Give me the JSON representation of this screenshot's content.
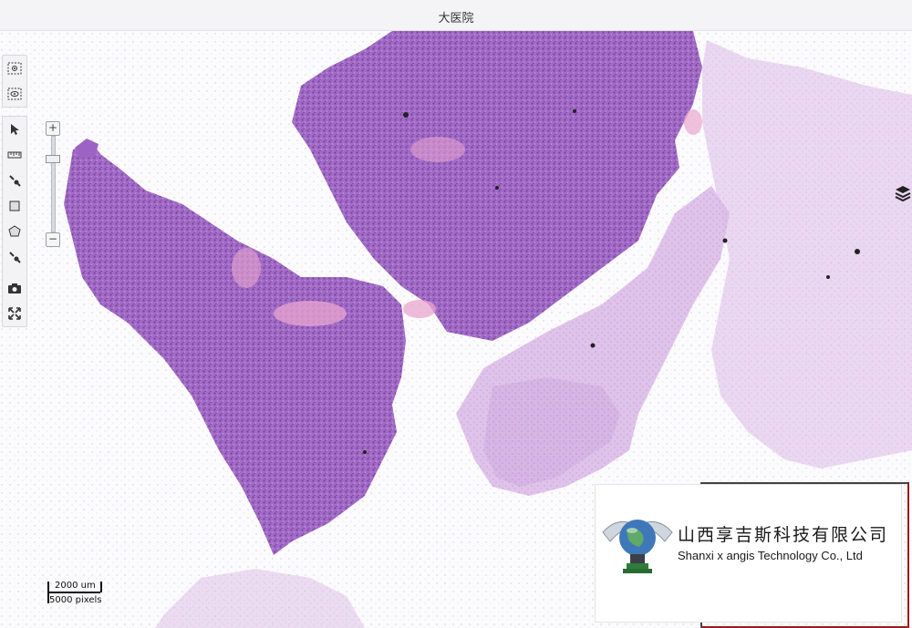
{
  "window": {
    "title": "大医院"
  },
  "toolbar_top": [
    {
      "name": "region-select-icon",
      "label": ""
    },
    {
      "name": "region-view-icon",
      "label": ""
    }
  ],
  "toolbar_main": [
    {
      "name": "pointer-icon"
    },
    {
      "name": "ruler-icon"
    },
    {
      "name": "pen-icon"
    },
    {
      "name": "rectangle-icon"
    },
    {
      "name": "polygon-icon"
    },
    {
      "name": "brush-icon"
    },
    {
      "name": "camera-icon"
    },
    {
      "name": "fullscreen-icon"
    }
  ],
  "zoom": {
    "plus_label": "+",
    "minus_label": "−",
    "level_fraction": 0.8
  },
  "scalebar": {
    "length_label": "2000 um",
    "pixels_label": "5000 pixels"
  },
  "logo": {
    "cn_name": "山西享吉斯科技有限公司",
    "en_name": "Shanxi x angis Technology Co., Ltd"
  },
  "colors": {
    "tissue_dark": "#8e55b8",
    "tissue_light": "#d9b6e6",
    "stroma_pink": "#e8a8d8",
    "overview_border": "#9b1c1c"
  }
}
